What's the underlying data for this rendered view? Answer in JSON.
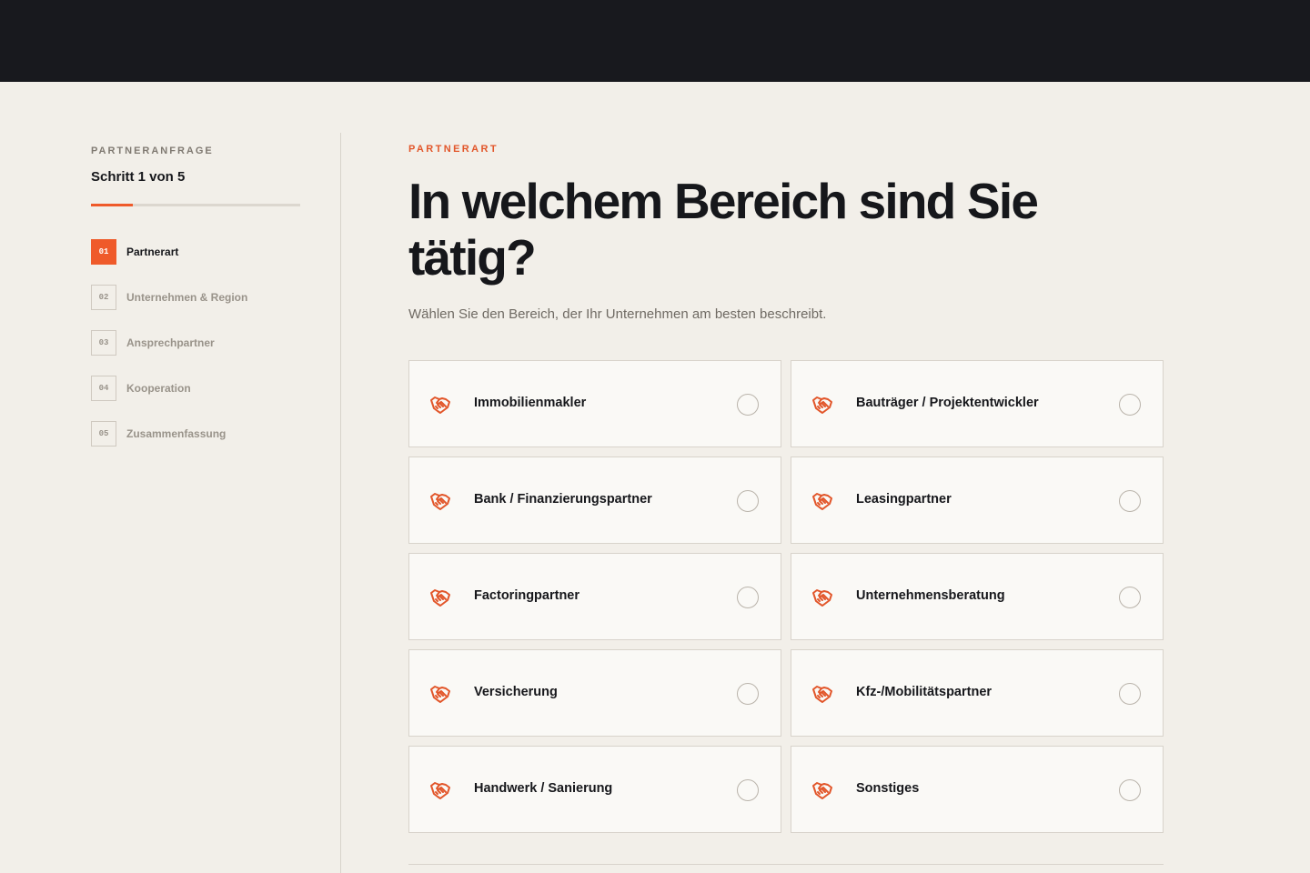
{
  "colors": {
    "accent": "#ef5a2a",
    "topbar": "#18191e",
    "background": "#f2efe9"
  },
  "sidebar": {
    "eyebrow": "PARTNERANFRAGE",
    "step_count": "Schritt 1 von 5",
    "progress": 0.2,
    "steps": [
      {
        "num": "01",
        "label": "Partnerart"
      },
      {
        "num": "02",
        "label": "Unternehmen & Region"
      },
      {
        "num": "03",
        "label": "Ansprechpartner"
      },
      {
        "num": "04",
        "label": "Kooperation"
      },
      {
        "num": "05",
        "label": "Zusammenfassung"
      }
    ]
  },
  "main": {
    "eyebrow": "PARTNERART",
    "title": "In welchem Bereich sind Sie tätig?",
    "subtitle": "Wählen Sie den Bereich, der Ihr Unternehmen am besten beschreibt.",
    "option_icon": "handshake-icon",
    "options": [
      {
        "label": "Immobilienmakler"
      },
      {
        "label": "Bauträger / Projektentwickler"
      },
      {
        "label": "Bank / Finanzierungspartner"
      },
      {
        "label": "Leasingpartner"
      },
      {
        "label": "Factoringpartner"
      },
      {
        "label": "Unternehmensberatung"
      },
      {
        "label": "Versicherung"
      },
      {
        "label": "Kfz-/Mobilitätspartner"
      },
      {
        "label": "Handwerk / Sanierung"
      },
      {
        "label": "Sonstiges"
      }
    ]
  }
}
